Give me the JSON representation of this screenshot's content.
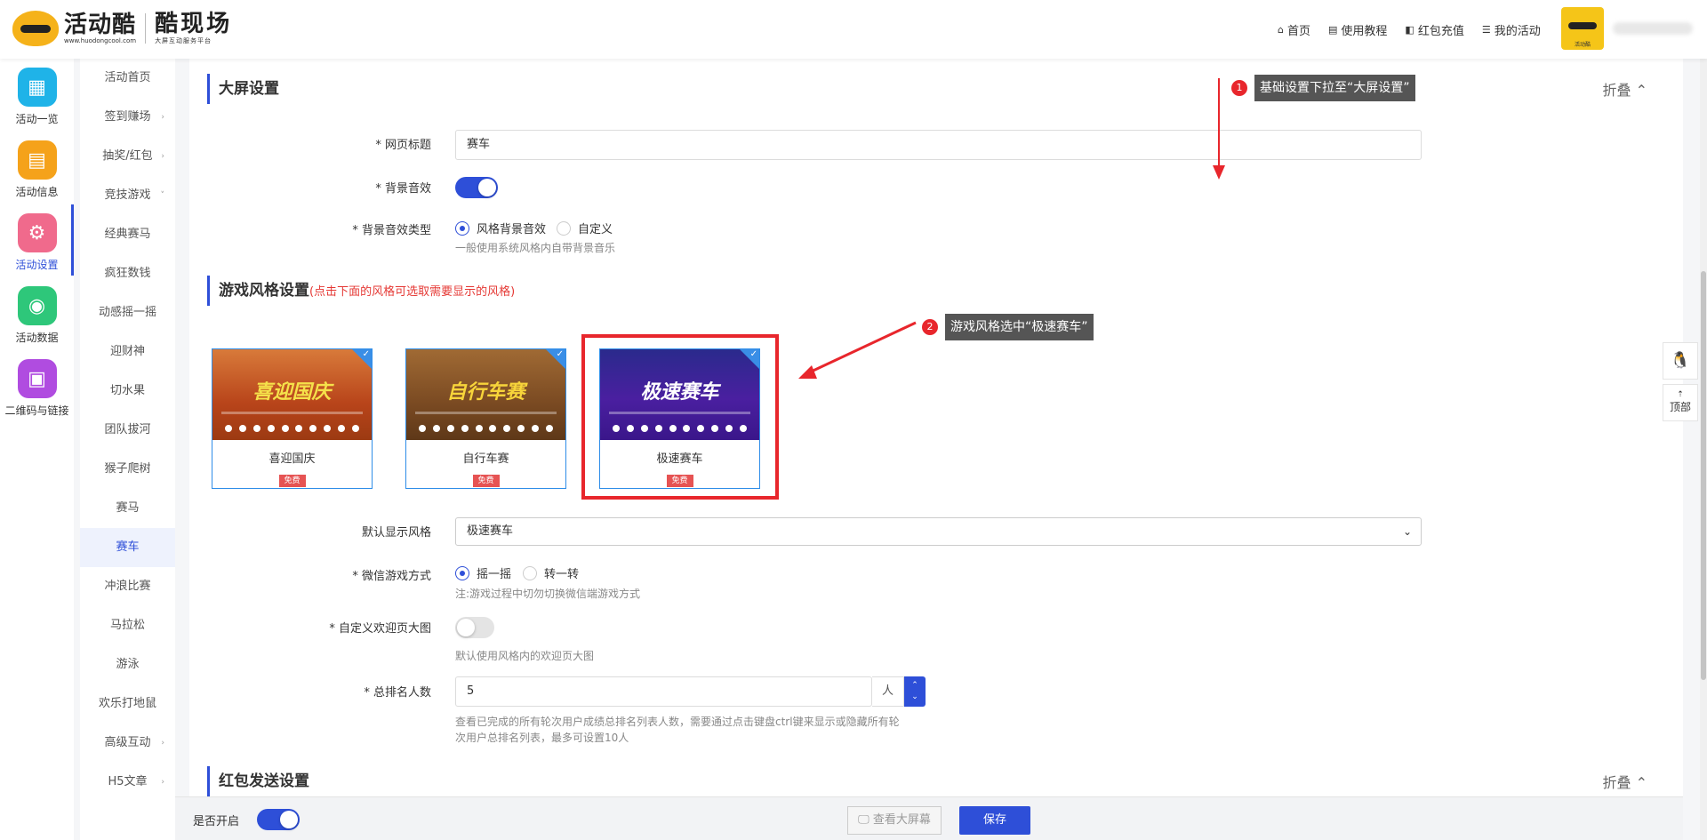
{
  "header": {
    "logo_name": "活动酷",
    "logo_url": "www.huodongcool.com",
    "logo_cool": "酷现场",
    "logo_cool_sub": "大屏互动服务平台",
    "nav": [
      {
        "icon": "⌂",
        "label": "首页"
      },
      {
        "icon": "▤",
        "label": "使用教程"
      },
      {
        "icon": "◧",
        "label": "红包充值"
      },
      {
        "icon": "☰",
        "label": "我的活动"
      }
    ],
    "avatar_label": "活动酷"
  },
  "iconbar": [
    {
      "label": "活动一览",
      "glyph": "▦",
      "color": "#1fb3e8"
    },
    {
      "label": "活动信息",
      "glyph": "▤",
      "color": "#f5a21a"
    },
    {
      "label": "活动设置",
      "glyph": "⚙",
      "color": "#f06a8c"
    },
    {
      "label": "活动数据",
      "glyph": "◉",
      "color": "#2ec77a"
    },
    {
      "label": "二维码与链接",
      "glyph": "▣",
      "color": "#b04ce0"
    }
  ],
  "subnav": [
    {
      "label": "活动首页",
      "chev": ""
    },
    {
      "label": "签到赚场",
      "chev": "›"
    },
    {
      "label": "抽奖/红包",
      "chev": "›"
    },
    {
      "label": "竞技游戏",
      "chev": "˅"
    },
    {
      "label": "经典赛马",
      "chev": ""
    },
    {
      "label": "疯狂数钱",
      "chev": ""
    },
    {
      "label": "动感摇一摇",
      "chev": ""
    },
    {
      "label": "迎财神",
      "chev": ""
    },
    {
      "label": "切水果",
      "chev": ""
    },
    {
      "label": "团队拔河",
      "chev": ""
    },
    {
      "label": "猴子爬树",
      "chev": ""
    },
    {
      "label": "赛马",
      "chev": ""
    },
    {
      "label": "赛车",
      "chev": ""
    },
    {
      "label": "冲浪比赛",
      "chev": ""
    },
    {
      "label": "马拉松",
      "chev": ""
    },
    {
      "label": "游泳",
      "chev": ""
    },
    {
      "label": "欢乐打地鼠",
      "chev": ""
    },
    {
      "label": "高级互动",
      "chev": "›"
    },
    {
      "label": "H5文章",
      "chev": "›"
    }
  ],
  "big_screen": {
    "title": "大屏设置",
    "collapse": "折叠 ⌃",
    "page_title_label": "* 网页标题",
    "page_title_value": "赛车",
    "bg_sound_label": "* 背景音效",
    "bg_sound_on": true,
    "bg_sound_type_label": "* 背景音效类型",
    "bg_sound_options": [
      "风格背景音效",
      "自定义"
    ],
    "bg_sound_help": "一般使用系统风格内自带背景音乐"
  },
  "game_style": {
    "title": "游戏风格设置",
    "hint": "(点击下面的风格可选取需要显示的风格)",
    "cards": [
      {
        "name": "喜迎国庆",
        "badge": "免费",
        "thumb_title": "喜迎国庆",
        "bg": "#c2541d",
        "fg": "#f5e14a"
      },
      {
        "name": "自行车赛",
        "badge": "免费",
        "thumb_title": "自行车赛",
        "bg": "#8a5b2e",
        "fg": "#f7d43a"
      },
      {
        "name": "极速赛车",
        "badge": "免费",
        "thumb_title": "极速赛车",
        "bg": "#3a1e8a",
        "fg": "#ffffff"
      }
    ],
    "default_style_label": "默认显示风格",
    "default_style_value": "极速赛车",
    "wechat_mode_label": "* 微信游戏方式",
    "wechat_mode_options": [
      "摇一摇",
      "转一转"
    ],
    "wechat_mode_help": "注:游戏过程中切勿切换微信端游戏方式",
    "custom_welcome_label": "* 自定义欢迎页大图",
    "custom_welcome_on": false,
    "custom_welcome_help": "默认使用风格内的欢迎页大图",
    "rank_label": "* 总排名人数",
    "rank_value": "5",
    "rank_unit": "人",
    "rank_help_1": "查看已完成的所有轮次用户成绩总排名列表人数，需要通过点击键盘ctrl键来显示或隐藏所有轮",
    "rank_help_2": "次用户总排名列表，最多可设置10人"
  },
  "redpacket": {
    "title": "红包发送设置",
    "collapse": "折叠 ⌃"
  },
  "annotations": [
    {
      "num": "1",
      "text": "基础设置下拉至“大屏设置”"
    },
    {
      "num": "2",
      "text": "游戏风格选中“极速赛车”"
    }
  ],
  "bottom": {
    "enable_label": "是否开启",
    "enable_on": true,
    "preview_label": "🖵 查看大屏幕",
    "save_label": "保存"
  },
  "floating": {
    "qq_icon": "🐧",
    "top_label": "顶部"
  }
}
